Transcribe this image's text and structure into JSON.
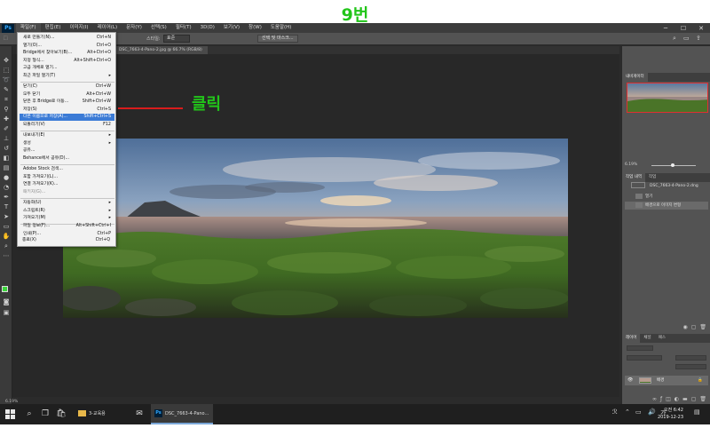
{
  "page_title": "9번",
  "annotation": {
    "text": "클릭",
    "color": "#22c51a",
    "line_color": "#d81c1c"
  },
  "menubar": {
    "logo": "Ps",
    "items": [
      "파일(F)",
      "편집(E)",
      "이미지(I)",
      "레이어(L)",
      "문자(Y)",
      "선택(S)",
      "필터(T)",
      "3D(D)",
      "보기(V)",
      "창(W)",
      "도움말(H)"
    ]
  },
  "options_bar": {
    "style_label": "스타일:",
    "style_value": "표준",
    "select_mask_button": "선택 및 마스크..."
  },
  "document_tab": "DSC_7663-4-Pano-2.jpg @ 66.7% (RGB/8)",
  "file_menu": {
    "items": [
      {
        "label": "새로 만들기(N)...",
        "shortcut": "Ctrl+N"
      },
      {
        "label": "열기(O)...",
        "shortcut": "Ctrl+O"
      },
      {
        "label": "Bridge에서 찾아보기(B)...",
        "shortcut": "Alt+Ctrl+O"
      },
      {
        "label": "지정 형식...",
        "shortcut": "Alt+Shift+Ctrl+O"
      },
      {
        "label": "고급 개체로 열기...",
        "shortcut": ""
      },
      {
        "label": "최근 파일 열기(T)",
        "shortcut": "▸"
      },
      {
        "label": "닫기(C)",
        "shortcut": "Ctrl+W"
      },
      {
        "label": "모두 닫기",
        "shortcut": "Alt+Ctrl+W"
      },
      {
        "label": "닫은 후 Bridge로 이동...",
        "shortcut": "Shift+Ctrl+W"
      },
      {
        "label": "저장(S)",
        "shortcut": "Ctrl+S"
      },
      {
        "label": "다른 이름으로 저장(A)...",
        "shortcut": "Shift+Ctrl+S"
      },
      {
        "label": "되돌리기(V)",
        "shortcut": "F12"
      },
      {
        "label": "내보내기(E)",
        "shortcut": "▸"
      },
      {
        "label": "생성",
        "shortcut": "▸"
      },
      {
        "label": "공유...",
        "shortcut": ""
      },
      {
        "label": "Behance에서 공유(D)...",
        "shortcut": ""
      },
      {
        "label": "Adobe Stock 검색...",
        "shortcut": ""
      },
      {
        "label": "포함 가져오기(L)...",
        "shortcut": ""
      },
      {
        "label": "연결 가져오기(K)...",
        "shortcut": ""
      },
      {
        "label": "패키지(G)...",
        "shortcut": ""
      },
      {
        "label": "자동화(U)",
        "shortcut": "▸"
      },
      {
        "label": "스크립트(R)",
        "shortcut": "▸"
      },
      {
        "label": "가져오기(M)",
        "shortcut": "▸"
      },
      {
        "label": "파일 정보(F)...",
        "shortcut": "Alt+Shift+Ctrl+I"
      },
      {
        "label": "인쇄(P)...",
        "shortcut": "Ctrl+P"
      },
      {
        "label": "한 부 인쇄(Y)",
        "shortcut": "Alt+Shift+Ctrl+P"
      },
      {
        "label": "종료(X)",
        "shortcut": "Ctrl+Q"
      }
    ]
  },
  "panels": {
    "navigator_tab": "내비게이터",
    "zoom_value": "6.19%",
    "history_tabs": [
      "작업 내역",
      "작업"
    ],
    "history_items": [
      "DSC_7663-4-Pano-2.dng",
      "열기",
      "배경으로 이미지 변형"
    ],
    "layers_tabs": [
      "레이어",
      "채널",
      "패스"
    ],
    "layer_name": "배경"
  },
  "status_bar": "6.19%",
  "taskbar": {
    "apps": [
      "3-교육용",
      "DSC_7663-4-Pano..."
    ],
    "time": "오전 6:42",
    "date": "2019-12-23"
  }
}
